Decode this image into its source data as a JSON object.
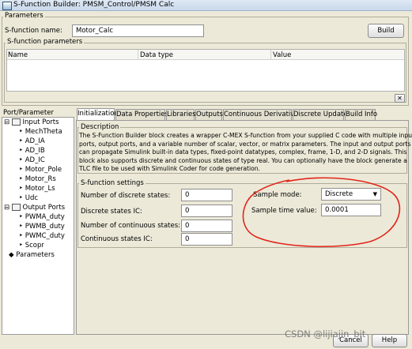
{
  "window": {
    "title": "S-Function Builder: PMSM_Control/PMSM Calc"
  },
  "parameters": {
    "group_label": "Parameters",
    "sfunction_name_label": "S-function name:",
    "sfunction_name_value": "Motor_Calc",
    "build_button": "Build",
    "sfunction_parameters_label": "S-function parameters",
    "columns": [
      "Name",
      "Data type",
      "Value"
    ],
    "close_button": "✕"
  },
  "port_parameter": {
    "label": "Port/Parameter",
    "input_ports_label": "Input Ports",
    "input_ports": [
      "MechTheta",
      "AD_IA",
      "AD_IB",
      "AD_IC",
      "Motor_Pole",
      "Motor_Rs",
      "Motor_Ls",
      "Udc"
    ],
    "output_ports_label": "Output Ports",
    "output_ports": [
      "PWMA_duty",
      "PWMB_duty",
      "PWMC_duty",
      "Scopr"
    ],
    "parameters_label": "Parameters"
  },
  "tabs": [
    "Initialization",
    "Data Properties",
    "Libraries",
    "Outputs",
    "Continuous Derivatives",
    "Discrete Update",
    "Build Info"
  ],
  "active_tab": "Initialization",
  "description": {
    "label": "Description",
    "lines": [
      "The S-Function Builder block creates a wrapper C-MEX S-function from your supplied C code with multiple input",
      "ports, output ports, and a variable number of scalar, vector, or matrix parameters. The input and output ports",
      "can propagate Simulink built-in data types, fixed-point datatypes, complex, frame, 1-D, and 2-D signals. This",
      "block also supports discrete and continuous states of type real. You can optionally have the block generate a",
      "TLC file to be used with Simulink Coder for code generation."
    ]
  },
  "settings": {
    "label": "S-function settings",
    "num_discrete_states_label": "Number of discrete states:",
    "num_discrete_states_value": "0",
    "discrete_states_ic_label": "Discrete states IC:",
    "discrete_states_ic_value": "0",
    "num_continuous_states_label": "Number of continuous states:",
    "num_continuous_states_value": "0",
    "continuous_states_ic_label": "Continuous states IC:",
    "continuous_states_ic_value": "0",
    "sample_mode_label": "Sample mode:",
    "sample_mode_value": "Discrete",
    "sample_time_label": "Sample time value:",
    "sample_time_value": "0.0001"
  },
  "footer": {
    "cancel_button": "Cancel",
    "help_button": "Help",
    "watermark": "CSDN @lijiajin_bit"
  },
  "colors": {
    "annotation": "#e2241a",
    "active_tab": "#ffffff",
    "dialog_bg": "#ece9d8"
  }
}
